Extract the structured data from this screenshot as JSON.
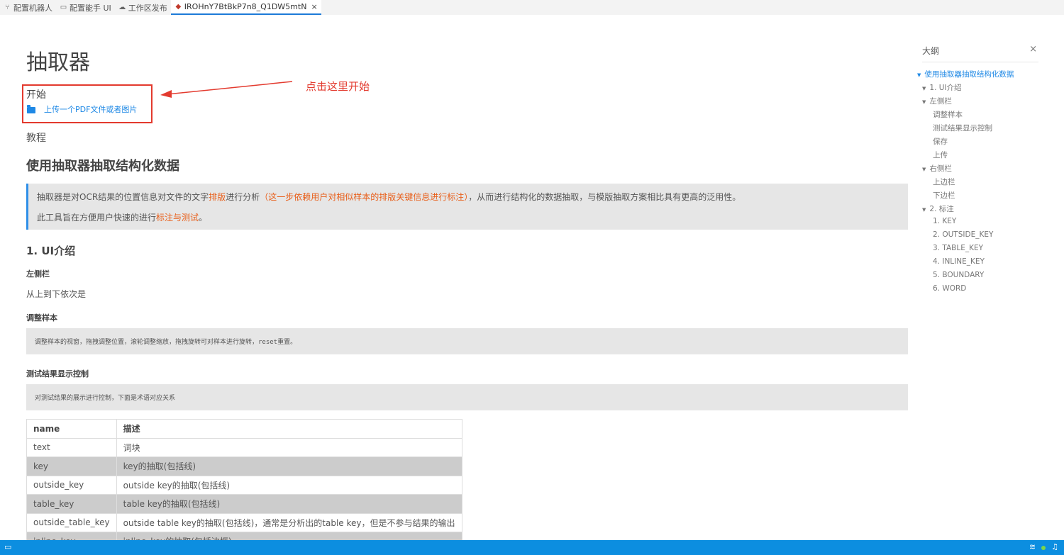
{
  "tabs": [
    {
      "icon": "git-branch-icon",
      "glyph": "⑂",
      "label": "配置机器人"
    },
    {
      "icon": "layout-icon",
      "glyph": "▭",
      "label": "配置能手 UI"
    },
    {
      "icon": "cloud-icon",
      "glyph": "☁",
      "label": "工作区发布"
    },
    {
      "icon": "layers-icon",
      "glyph": "◆",
      "label": "IROHnY7BtBkP7n8_Q1DW5mtN",
      "close": "×",
      "active": true
    }
  ],
  "doc": {
    "title": "抽取器",
    "start_label": "开始",
    "upload_link": "上传一个PDF文件或者图片",
    "annotation": "点击这里开始",
    "tutorial_label": "教程",
    "heading": "使用抽取器抽取结构化数据",
    "quote": {
      "p1_a": "抽取器是对OCR结果的位置信息对文件的文字",
      "p1_b": "排版",
      "p1_c": "进行分析",
      "p1_d": "（这一步依赖用户对相似样本的排版关键信息进行标注）",
      "p1_e": "，从而进行结构化的数据抽取，与模版抽取方案相比具有更高的泛用性。",
      "p2_a": "此工具旨在方便用户快速的进行",
      "p2_b": "标注与测试",
      "p2_c": "。"
    },
    "section_ui": "1. UI介绍",
    "left_sidebar": "左侧栏",
    "left_sidebar_desc": "从上到下依次是",
    "adjust_sample": "调整样本",
    "adjust_sample_code": "调整样本的视窗，拖拽调整位置，滚轮调整缩放，拖拽旋转可对样本进行旋转，reset重置。",
    "test_display": "测试结果显示控制",
    "test_display_code": "对测试结果的展示进行控制，下面是术语对应关系",
    "table_headers": [
      "name",
      "描述"
    ],
    "table_rows": [
      [
        "text",
        "词块"
      ],
      [
        "key",
        "key的抽取(包括线)"
      ],
      [
        "outside_key",
        "outside key的抽取(包括线)"
      ],
      [
        "table_key",
        "table key的抽取(包括线)"
      ],
      [
        "outside_table_key",
        "outside table key的抽取(包括线)，通常是分析出的table key，但是不参与结果的输出"
      ],
      [
        "inline_key",
        "inline_key的抽取(包括边框)"
      ]
    ]
  },
  "outline": {
    "title": "大纲",
    "close": "×",
    "items": [
      {
        "label": "使用抽取器抽取结构化数据",
        "level": 0,
        "arrow": "▼",
        "active": true
      },
      {
        "label": "1. UI介绍",
        "level": 1,
        "arrow": "▼"
      },
      {
        "label": "左侧栏",
        "level": 1,
        "arrow": "▼"
      },
      {
        "label": "调整样本",
        "level": 2
      },
      {
        "label": "测试结果显示控制",
        "level": 2
      },
      {
        "label": "保存",
        "level": 2
      },
      {
        "label": "上传",
        "level": 2
      },
      {
        "label": "右侧栏",
        "level": 1,
        "arrow": "▼"
      },
      {
        "label": "上边栏",
        "level": 2
      },
      {
        "label": "下边栏",
        "level": 2
      },
      {
        "label": "2. 标注",
        "level": 1,
        "arrow": "▼"
      },
      {
        "label": "1. KEY",
        "level": 2
      },
      {
        "label": "2. OUTSIDE_KEY",
        "level": 2
      },
      {
        "label": "3. TABLE_KEY",
        "level": 2
      },
      {
        "label": "4. INLINE_KEY",
        "level": 2
      },
      {
        "label": "5. BOUNDARY",
        "level": 2
      },
      {
        "label": "6. WORD",
        "level": 2
      }
    ]
  },
  "statusbar": {
    "left_icon": "monitor-icon",
    "left_glyph": "▭",
    "wifi_icon": "wifi-icon",
    "wifi_glyph": "≋",
    "bell_icon": "bell-icon",
    "bell_glyph": "♫"
  },
  "colors": {
    "accent": "#1e88e5",
    "annotation": "#e33a2e",
    "status": "#0c8ee0",
    "highlight": "#e8601c"
  }
}
